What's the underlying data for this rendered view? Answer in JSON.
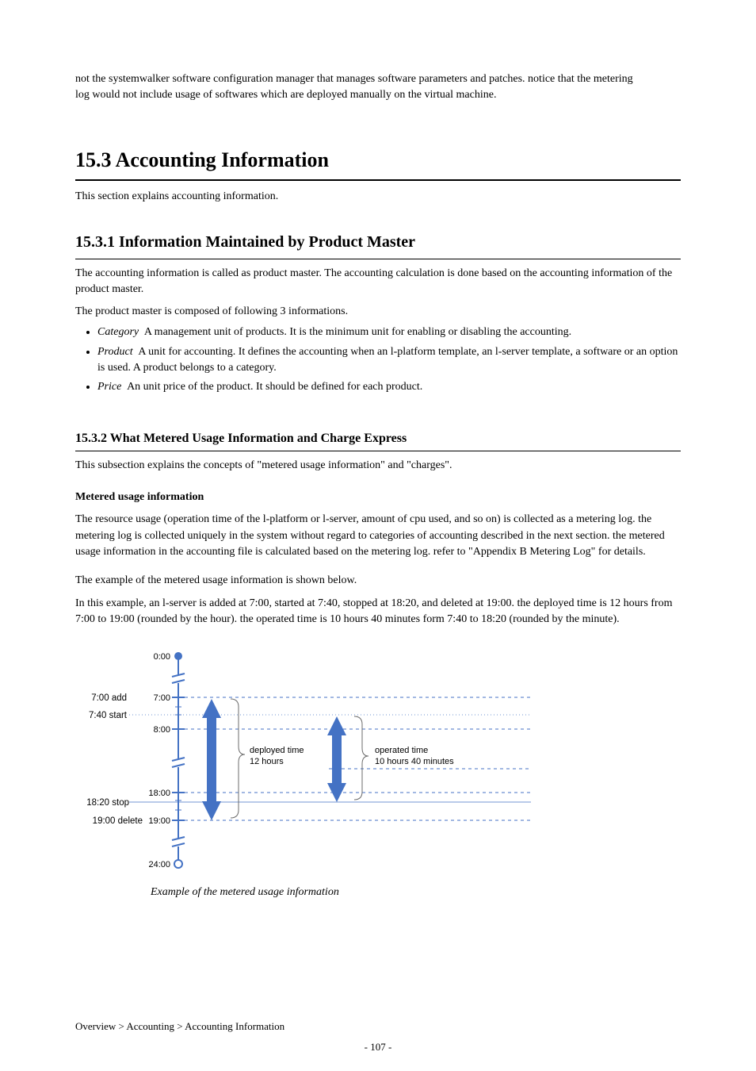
{
  "intro": {
    "line1": "not the systemwalker software configuration manager that manages software parameters and patches. notice that the metering",
    "line2": "log would not include usage of softwares which are deployed manually on the virtual machine."
  },
  "section15": {
    "heading": "15.3 Accounting Information",
    "lead": "This section explains accounting information."
  },
  "section15_1": {
    "heading": "15.3.1 Information Maintained by Product Master",
    "para1": "The accounting information is called as product master. The accounting calculation is done based on the accounting information of the product master.",
    "para2": "The product master is composed of following 3 informations.",
    "concepts": [
      {
        "name": "Category",
        "desc": "A management unit of products. It is the minimum unit for enabling or disabling the accounting."
      },
      {
        "name": "Product",
        "desc": "A unit for accounting. It defines the accounting when an l-platform template, an l-server template, a software or an option is used. A product belongs to a category."
      },
      {
        "name": "Price",
        "desc": "An unit price of the product. It should be defined for each product."
      }
    ]
  },
  "section15_2": {
    "heading": "15.3.2 What Metered Usage Information and Charge Express",
    "para1": "This subsection explains the concepts of \"metered usage information\" and \"charges\".",
    "h_metered": "Metered usage information",
    "metered_body": "The resource usage (operation time of the l-platform or l-server, amount of cpu used, and so on) is collected as a metering log. the metering log is collected uniquely in the system without regard to categories of accounting described in the next section. the metered usage information in the accounting file is calculated based on the metering log. refer to \"Appendix B Metering Log\" for details.",
    "example_lead": "The example of the metered usage information is shown below.",
    "example_body": "In this example, an l-server is added at 7:00, started at 7:40, stopped at 18:20, and deleted at 19:00. the deployed time is 12 hours from 7:00 to 19:00 (rounded by the hour). the operated time is 10 hours 40 minutes form 7:40 to 18:20 (rounded by the minute)."
  },
  "diagram": {
    "events": [
      {
        "time": "7:00",
        "action": "add"
      },
      {
        "time": "7:40",
        "action": "start"
      },
      {
        "time": "18:20",
        "action": "stop"
      },
      {
        "time": "19:00",
        "action": "delete"
      }
    ],
    "ticks": [
      "0:00",
      "7:00",
      "8:00",
      "18:00",
      "19:00",
      "24:00"
    ],
    "deployed_label_l1": "deployed time",
    "deployed_label_l2": "12 hours",
    "operated_label_l1": "operated time",
    "operated_label_l2": "10 hours 40 minutes"
  },
  "caption": "Example of the metered usage information",
  "footer": {
    "breadcrumb": "Overview > Accounting > Accounting Information",
    "pagenum": "- 107 -"
  }
}
